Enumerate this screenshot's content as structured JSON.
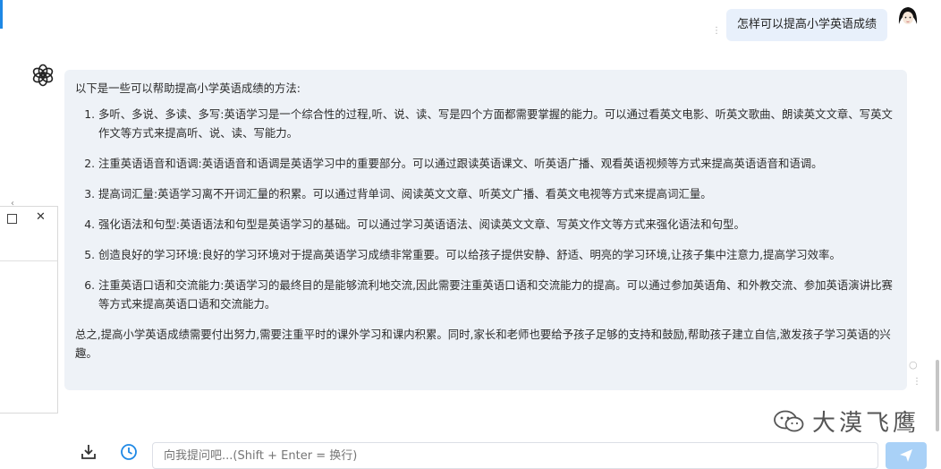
{
  "user_message": "怎样可以提高小学英语成绩",
  "assistant": {
    "intro": "以下是一些可以帮助提高小学英语成绩的方法:",
    "items": [
      "多听、多说、多读、多写:英语学习是一个综合性的过程,听、说、读、写是四个方面都需要掌握的能力。可以通过看英文电影、听英文歌曲、朗读英文文章、写英文作文等方式来提高听、说、读、写能力。",
      "注重英语语音和语调:英语语音和语调是英语学习中的重要部分。可以通过跟读英语课文、听英语广播、观看英语视频等方式来提高英语语音和语调。",
      "提高词汇量:英语学习离不开词汇量的积累。可以通过背单词、阅读英文文章、听英文广播、看英文电视等方式来提高词汇量。",
      "强化语法和句型:英语语法和句型是英语学习的基础。可以通过学习英语语法、阅读英文文章、写英文作文等方式来强化语法和句型。",
      "创造良好的学习环境:良好的学习环境对于提高英语学习成绩非常重要。可以给孩子提供安静、舒适、明亮的学习环境,让孩子集中注意力,提高学习效率。",
      "注重英语口语和交流能力:英语学习的最终目的是能够流利地交流,因此需要注重英语口语和交流能力的提高。可以通过参加英语角、和外教交流、参加英语演讲比赛等方式来提高英语口语和交流能力。"
    ],
    "outro": "总之,提高小学英语成绩需要付出努力,需要注重平时的课外学习和课内积累。同时,家长和老师也要给予孩子足够的支持和鼓励,帮助孩子建立自信,激发孩子学习英语的兴趣。"
  },
  "watermark": "大漠飞鹰",
  "input": {
    "placeholder": "向我提问吧...(Shift + Enter = 换行)"
  },
  "icons": {
    "download": "download-icon",
    "history": "history-icon",
    "send": "send-icon",
    "bot": "chatgpt-logo-icon",
    "avatar": "user-avatar"
  },
  "colors": {
    "accent": "#1e88e5",
    "bubble_user": "#e8f0fb",
    "bubble_bot": "#eef2f7",
    "send": "#a9d1f7"
  }
}
